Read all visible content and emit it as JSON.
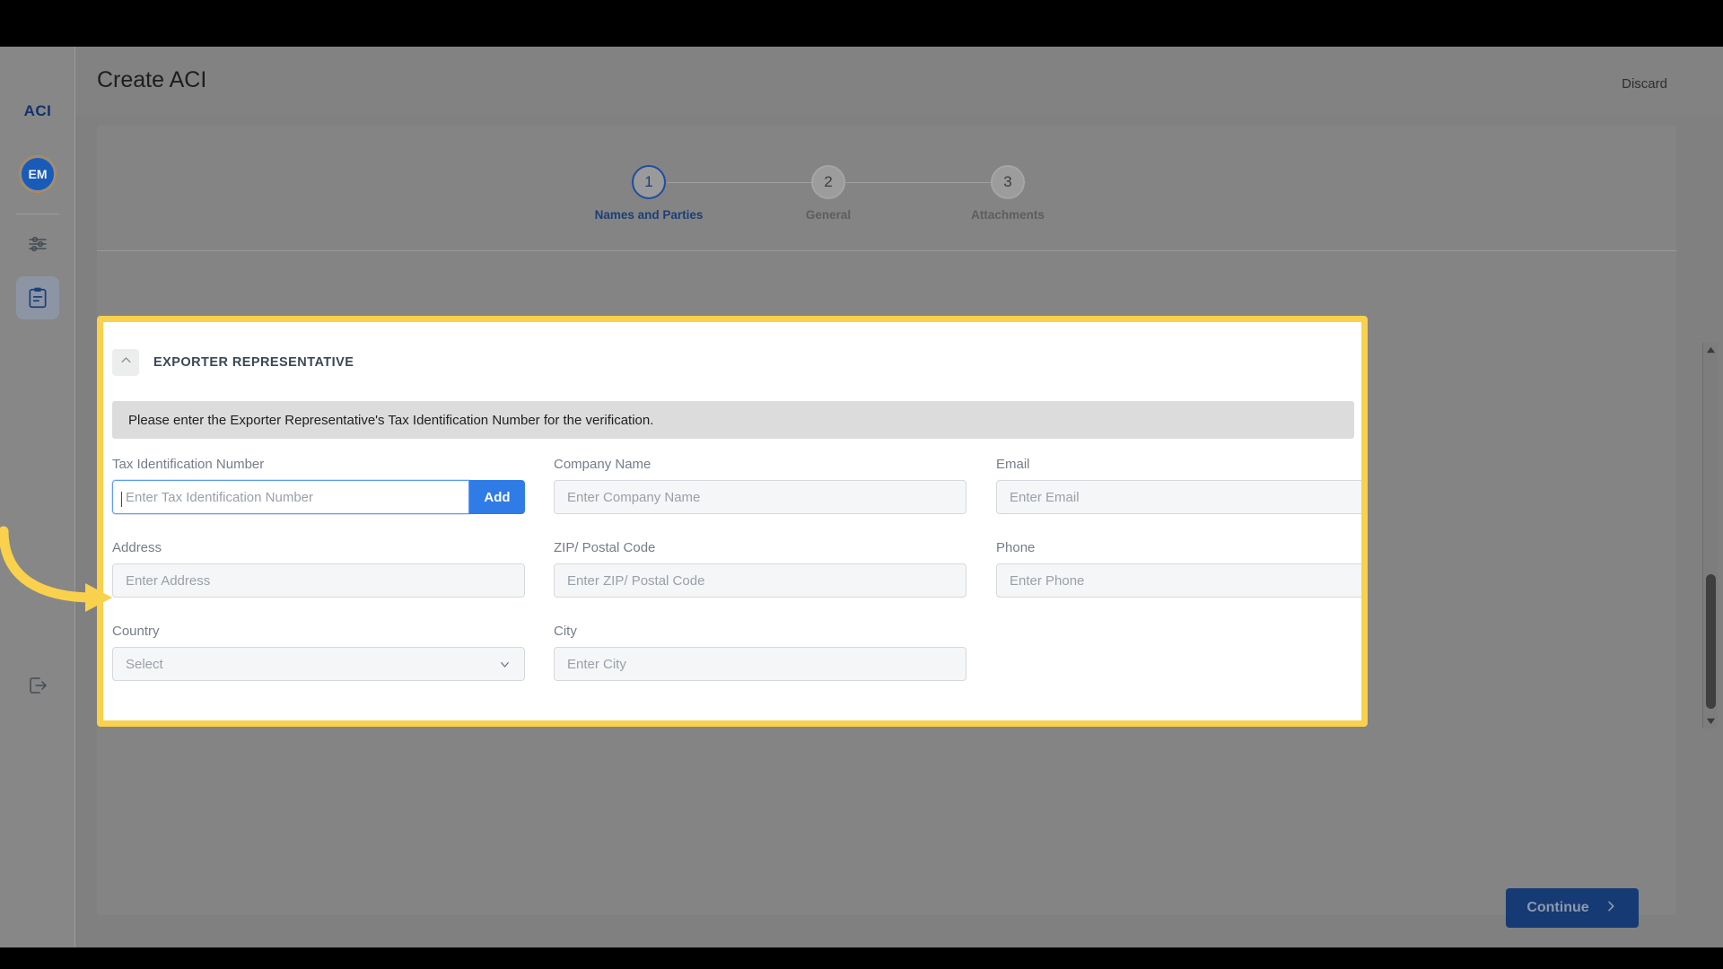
{
  "sidebar": {
    "logo": "ACI",
    "avatar_initials": "EM",
    "items": [
      {
        "name": "sliders-icon",
        "label": ""
      },
      {
        "name": "clipboard-icon",
        "label": ""
      },
      {
        "name": "logout-icon",
        "label": ""
      }
    ]
  },
  "header": {
    "title": "Create ACI",
    "discard_label": "Discard"
  },
  "stepper": {
    "steps": [
      {
        "number": "1",
        "label": "Names and Parties",
        "state": "active"
      },
      {
        "number": "2",
        "label": "General",
        "state": "inactive"
      },
      {
        "number": "3",
        "label": "Attachments",
        "state": "inactive"
      }
    ]
  },
  "panel": {
    "section_title": "EXPORTER REPRESENTATIVE",
    "collapse_icon": "chevron-up-icon",
    "info_text": "Please enter the Exporter Representative's Tax Identification Number for the verification.",
    "add_button_label": "Add",
    "fields": {
      "tin": {
        "label": "Tax Identification Number",
        "placeholder": "Enter Tax Identification Number",
        "value": ""
      },
      "company": {
        "label": "Company Name",
        "placeholder": "Enter Company Name",
        "value": ""
      },
      "email": {
        "label": "Email",
        "placeholder": "Enter Email",
        "value": ""
      },
      "address": {
        "label": "Address",
        "placeholder": "Enter Address",
        "value": ""
      },
      "zip": {
        "label": "ZIP/ Postal Code",
        "placeholder": "Enter ZIP/ Postal Code",
        "value": ""
      },
      "phone": {
        "label": "Phone",
        "placeholder": "Enter Phone",
        "value": ""
      },
      "country": {
        "label": "Country",
        "placeholder": "Select",
        "value": ""
      },
      "city": {
        "label": "City",
        "placeholder": "Enter City",
        "value": ""
      }
    }
  },
  "footer": {
    "continue_label": "Continue"
  },
  "colors": {
    "highlight": "#f9d14c",
    "primary_blue": "#2f7ce6",
    "navy": "#163a74",
    "step_active": "#1b4fa0"
  }
}
